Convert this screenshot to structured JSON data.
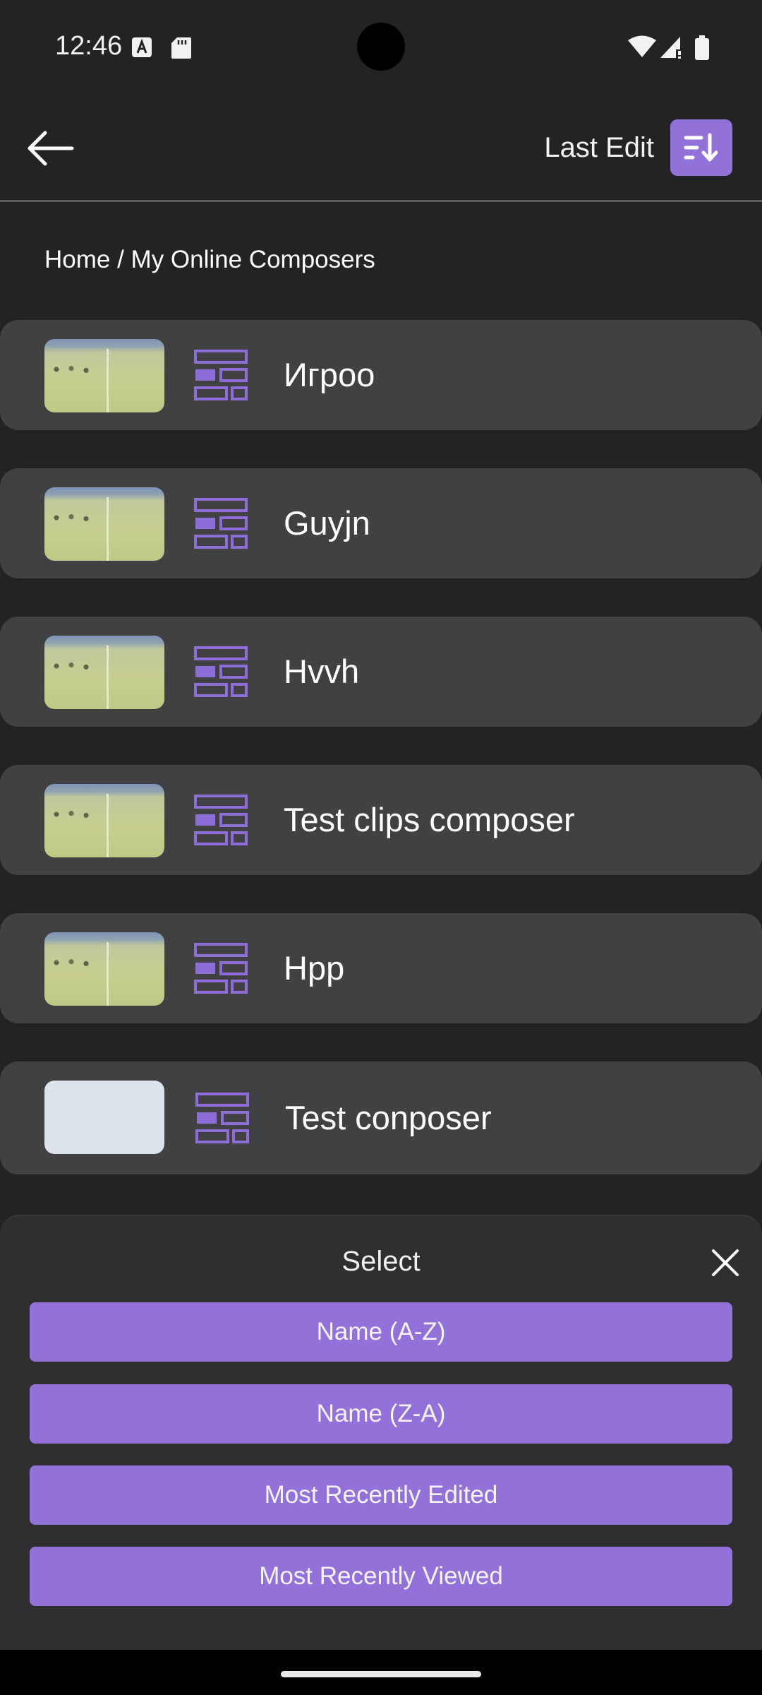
{
  "status_bar": {
    "time": "12:46"
  },
  "app_bar": {
    "sort_label": "Last Edit"
  },
  "breadcrumb": "Home / My Online Composers",
  "composers": [
    {
      "title": "Игроо",
      "thumbnail": "video-frame"
    },
    {
      "title": "Guyjn",
      "thumbnail": "video-frame"
    },
    {
      "title": "Hvvh",
      "thumbnail": "video-frame"
    },
    {
      "title": "Test clips composer",
      "thumbnail": "video-frame"
    },
    {
      "title": "Hpp",
      "thumbnail": "video-frame"
    },
    {
      "title": "Test conposer",
      "thumbnail": "blank"
    }
  ],
  "sort_sheet": {
    "title": "Select",
    "options": [
      "Name (A-Z)",
      "Name (Z-A)",
      "Most Recently Edited",
      "Most Recently Viewed"
    ]
  },
  "colors": {
    "accent": "#9272d9",
    "background": "#232225",
    "row": "#414043",
    "sheet": "#2f2e31"
  }
}
